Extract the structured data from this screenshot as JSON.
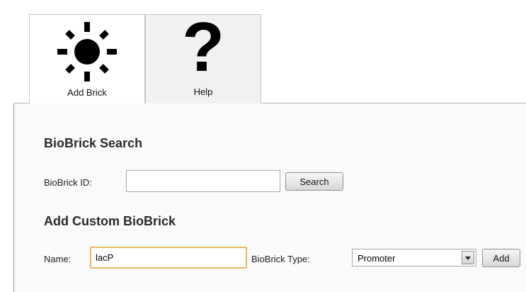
{
  "tabs": [
    {
      "label": "Add Brick",
      "icon": "sun-icon",
      "active": true
    },
    {
      "label": "Help",
      "icon": "question-mark-icon",
      "glyph": "?",
      "active": false
    }
  ],
  "search_section": {
    "title": "BioBrick Search",
    "id_label": "BioBrick ID:",
    "id_value": "",
    "search_button": "Search"
  },
  "custom_section": {
    "title": "Add Custom BioBrick",
    "name_label": "Name:",
    "name_value": "lacP",
    "type_label": "BioBrick Type:",
    "type_value": "Promoter",
    "add_button": "Add"
  }
}
